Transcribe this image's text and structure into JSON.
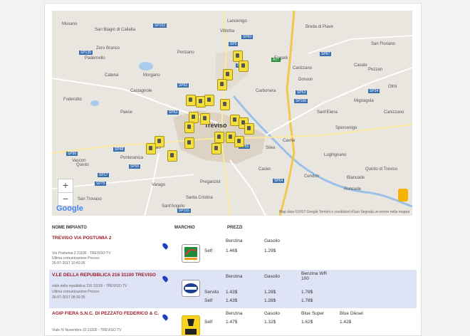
{
  "map": {
    "zoom_in": "+",
    "zoom_out": "−",
    "google_logo": "Google",
    "footer": "Map data ©2017 Google    Termini e condizioni d'uso    Segnala un errore nella mappa",
    "city": "Treviso",
    "places": [
      "Musano",
      "Quinto",
      "Paese",
      "Ponzano",
      "Villorba",
      "Lancenigo",
      "Breda di Piave",
      "Carbonera",
      "Silea",
      "Casale",
      "Preganziol",
      "Zero Branco",
      "Morgano",
      "Castagnole",
      "Fuderutto",
      "Padernello",
      "Camalò",
      "Spercenigo",
      "Cendon",
      "Lughignano",
      "Roncade",
      "Casier",
      "Dosson",
      "Carizzano",
      "Mignagola",
      "San Biagio di Callalta",
      "Vascon",
      "Santa Cristina",
      "San Trovaso",
      "Ponteranica",
      "Quinto di Treviso",
      "Biancade",
      "Sant'Elena",
      "Olmi",
      "San Floriano",
      "Fagarè",
      "Pezzan",
      "Cavrie",
      "Catena",
      "Varago",
      "Canizzano",
      "Sant'Angelo",
      "Vittoria"
    ],
    "roads": [
      "SP102",
      "SP60",
      "SP135",
      "SP5",
      "SP106",
      "SP17",
      "SP53",
      "SP55",
      "SP48",
      "SP90",
      "SP62",
      "SP79",
      "SP64",
      "SP67",
      "SP34",
      "SP115",
      "SP65",
      "SP63",
      "A27",
      "SS53"
    ]
  },
  "table": {
    "col_name": "NOME IMPIANTO",
    "col_brand": "MARCHIO",
    "col_prices": "PREZZI",
    "rows": [
      {
        "name": "TREVISO VIA POSTUMIA 2",
        "address": "Via Postumia 2 31100 - TREVISO TV",
        "last_update_label": "Ultima comunicazione Prezzo:",
        "last_update": "26-07-2017 10:40:35",
        "brand_icon": "total-erg-logo",
        "fuels": [
          "Benzina",
          "Gasolio"
        ],
        "services": [
          {
            "label": "Self",
            "prices": [
              "1.46$",
              "1.29$"
            ]
          }
        ]
      },
      {
        "name": "V.LE DELLA REPUBBLICA 216 31100 TREVISO",
        "address": "viale della repubblica 216 31100 - TREVISO TV",
        "last_update_label": "Ultima comunicazione Prezzo:",
        "last_update": "26-07-2017 08:30:35",
        "brand_icon": "tamoil-logo",
        "fuels": [
          "Benzina",
          "Gasolio",
          "Benzina WR 100"
        ],
        "services": [
          {
            "label": "Servito",
            "prices": [
              "1.43$",
              "1.28$",
              "1.78$"
            ]
          },
          {
            "label": "Self",
            "prices": [
              "1.43$",
              "1.28$",
              "1.78$"
            ]
          }
        ]
      },
      {
        "name": "AGIP FIERA S.N.C. DI PEZZATO FEDERICO & C.",
        "address": "Viale IV Novembre 23 31100 - TREVISO TV",
        "brand_icon": "eni-logo",
        "fuels": [
          "Benzina",
          "Gasolio",
          "Blue Super",
          "Blue Diesel"
        ],
        "services": [
          {
            "label": "Self",
            "prices": [
              "1.47$",
              "1.32$",
              "1.62$",
              "1.42$"
            ]
          }
        ]
      }
    ]
  },
  "colors": {
    "station_name": "#9b1b28",
    "highlight_row": "#dfe3f6",
    "marker": "#f3de3c",
    "road_blue": "#3a6fb0"
  }
}
